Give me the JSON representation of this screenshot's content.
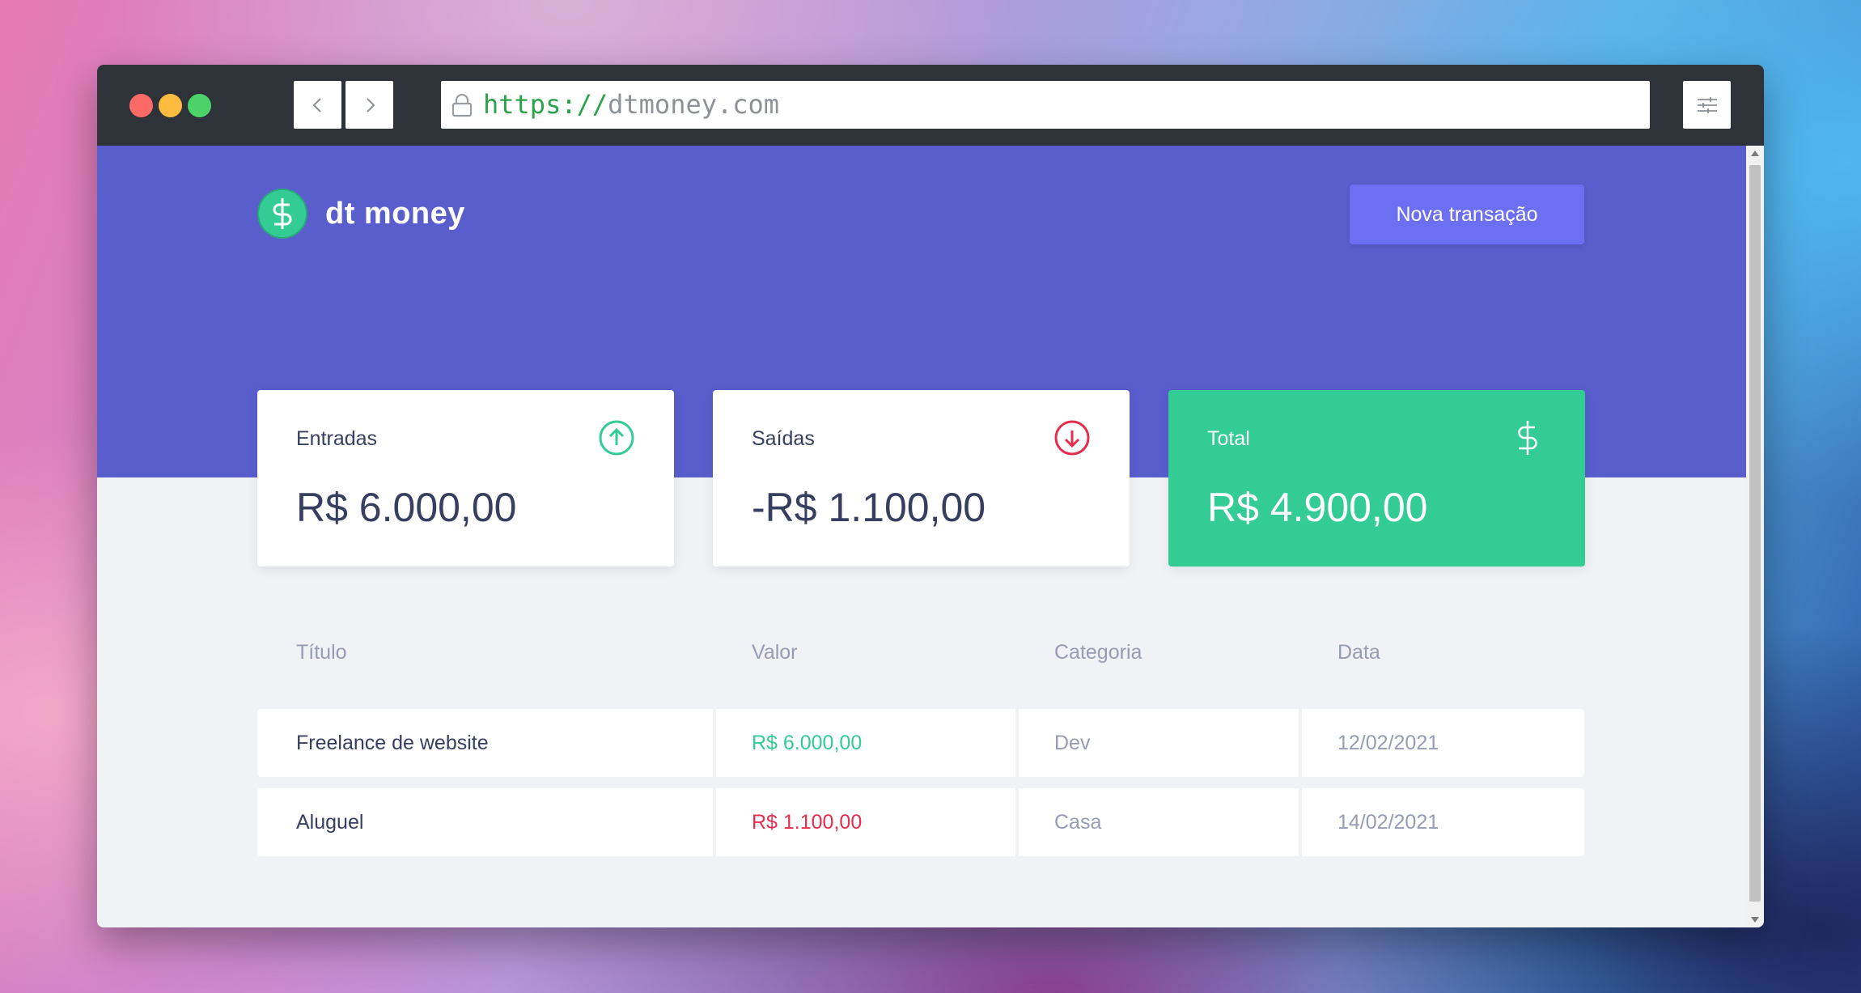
{
  "browser": {
    "url_scheme": "https://",
    "url_host": "dtmoney.com"
  },
  "header": {
    "logo_text": "dt money",
    "new_transaction_label": "Nova transação"
  },
  "summary": {
    "income": {
      "label": "Entradas",
      "value": "R$ 6.000,00",
      "icon": "arrow-up-circle-icon",
      "color": "#33cc95"
    },
    "outcome": {
      "label": "Saídas",
      "value": "-R$ 1.100,00",
      "icon": "arrow-down-circle-icon",
      "color": "#e52e4d"
    },
    "total": {
      "label": "Total",
      "value": "R$ 4.900,00",
      "icon": "dollar-sign-icon",
      "color": "#33cc95"
    }
  },
  "table": {
    "headers": [
      "Título",
      "Valor",
      "Categoria",
      "Data"
    ],
    "rows": [
      {
        "title": "Freelance de website",
        "amount": "R$ 6.000,00",
        "type": "deposit",
        "category": "Dev",
        "date": "12/02/2021"
      },
      {
        "title": "Aluguel",
        "amount": "R$ 1.100,00",
        "type": "withdraw",
        "category": "Casa",
        "date": "14/02/2021"
      }
    ]
  },
  "colors": {
    "header_bg": "#5a5ecd",
    "page_bg": "#f0f2f5",
    "button_bg": "#6c6ff2",
    "green": "#33cc95",
    "red": "#e52e4d",
    "text_title": "#363f5f",
    "text_body": "#969cb3"
  }
}
